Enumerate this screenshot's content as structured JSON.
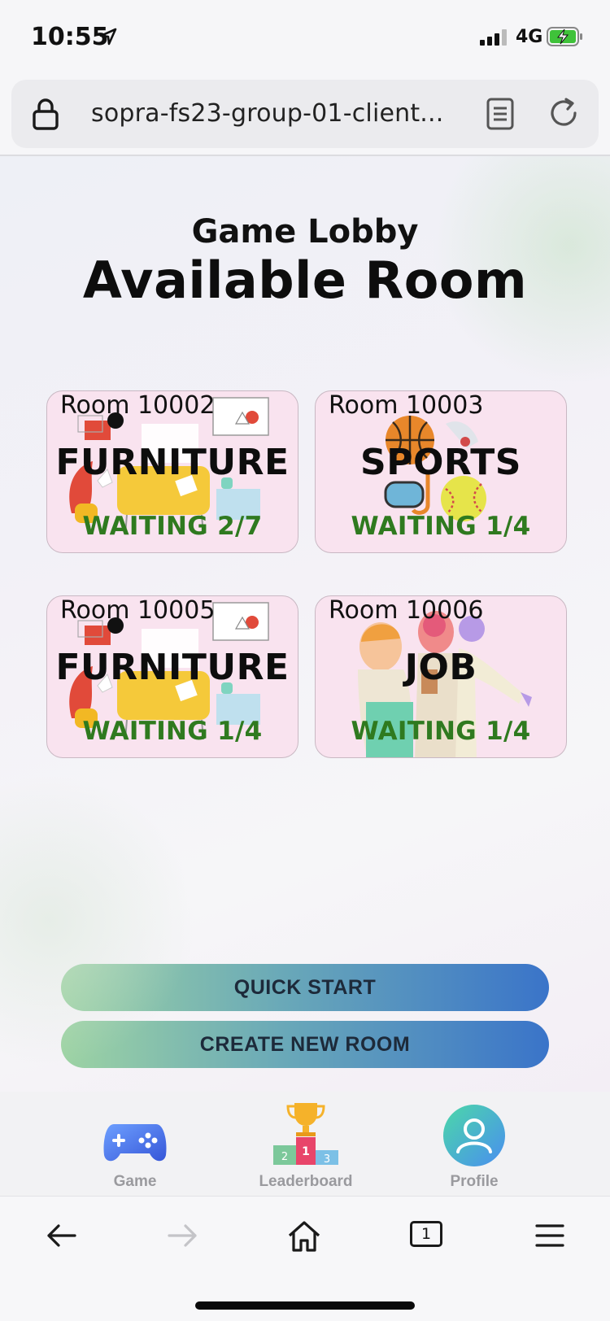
{
  "status_bar": {
    "time": "10:55",
    "network": "4G"
  },
  "browser": {
    "url": "sopra-fs23-group-01-client...",
    "tab_count": "1"
  },
  "lobby": {
    "subtitle": "Game Lobby",
    "title": "Available Room",
    "rooms": [
      {
        "id": "Room 10002",
        "theme": "FURNITURE",
        "status": "WAITING 2/7"
      },
      {
        "id": "Room 10003",
        "theme": "SPORTS",
        "status": "WAITING 1/4"
      },
      {
        "id": "Room 10005",
        "theme": "FURNITURE",
        "status": "WAITING 1/4"
      },
      {
        "id": "Room 10006",
        "theme": "JOB",
        "status": "WAITING 1/4"
      }
    ],
    "quick_start_label": "QUICK START",
    "create_room_label": "CREATE NEW ROOM"
  },
  "tabs": [
    {
      "label": "Game",
      "icon": "gamepad-icon"
    },
    {
      "label": "Leaderboard",
      "icon": "trophy-podium-icon"
    },
    {
      "label": "Profile",
      "icon": "profile-icon"
    }
  ],
  "colors": {
    "room_card": "#f9e3ef",
    "waiting_text": "#2f7a1f",
    "button_gradient_start": "#9dd3a3",
    "button_gradient_end": "#3a74c9"
  }
}
